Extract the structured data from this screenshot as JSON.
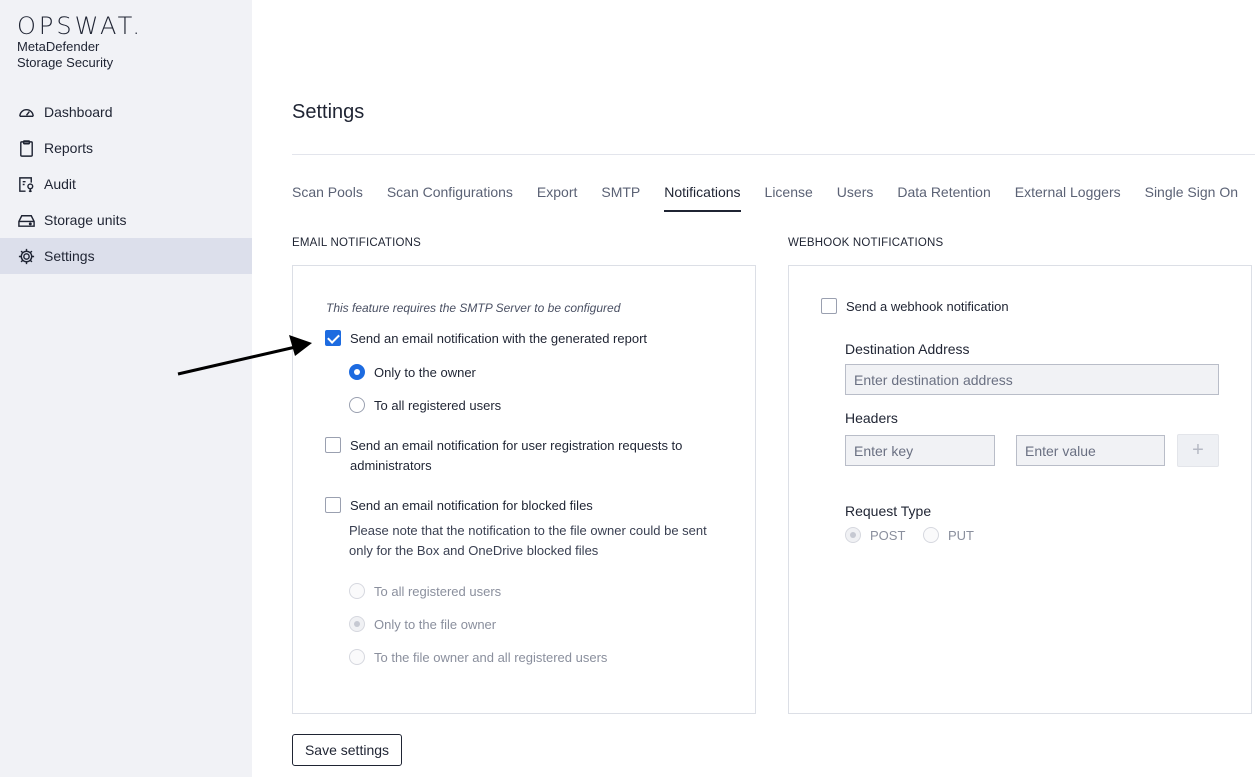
{
  "brand": {
    "logo": "OPSWAT.",
    "product_line1": "MetaDefender",
    "product_line2": "Storage Security"
  },
  "sidebar": {
    "items": [
      {
        "label": "Dashboard",
        "icon": "gauge-icon",
        "active": false
      },
      {
        "label": "Reports",
        "icon": "clipboard-icon",
        "active": false
      },
      {
        "label": "Audit",
        "icon": "audit-icon",
        "active": false
      },
      {
        "label": "Storage units",
        "icon": "drive-icon",
        "active": false
      },
      {
        "label": "Settings",
        "icon": "gear-icon",
        "active": true
      }
    ]
  },
  "page": {
    "title": "Settings"
  },
  "tabs": [
    {
      "label": "Scan Pools"
    },
    {
      "label": "Scan Configurations"
    },
    {
      "label": "Export"
    },
    {
      "label": "SMTP"
    },
    {
      "label": "Notifications",
      "active": true
    },
    {
      "label": "License"
    },
    {
      "label": "Users"
    },
    {
      "label": "Data Retention"
    },
    {
      "label": "External Loggers"
    },
    {
      "label": "Single Sign On"
    }
  ],
  "email": {
    "section_label": "EMAIL NOTIFICATIONS",
    "note": "This feature requires the SMTP Server to be configured",
    "report_checkbox": {
      "label": "Send an email notification with the generated report",
      "checked": true
    },
    "report_options": [
      {
        "label": "Only to the owner",
        "selected": true
      },
      {
        "label": "To all registered users",
        "selected": false
      }
    ],
    "registration_checkbox": {
      "label": "Send an email notification for user registration requests to administrators",
      "checked": false
    },
    "blocked_checkbox": {
      "label": "Send an email notification for blocked files",
      "checked": false
    },
    "blocked_description": "Please note that the notification to the file owner could be sent only for the Box and OneDrive blocked files",
    "blocked_options": [
      {
        "label": "To all registered users",
        "selected": false
      },
      {
        "label": "Only to the file owner",
        "selected": true
      },
      {
        "label": "To the file owner and all registered users",
        "selected": false
      }
    ]
  },
  "webhook": {
    "section_label": "WEBHOOK NOTIFICATIONS",
    "checkbox": {
      "label": "Send a webhook notification",
      "checked": false
    },
    "destination_label": "Destination Address",
    "destination_placeholder": "Enter destination address",
    "headers_label": "Headers",
    "key_placeholder": "Enter key",
    "value_placeholder": "Enter value",
    "add_symbol": "+",
    "request_type_label": "Request Type",
    "request_types": [
      {
        "label": "POST",
        "selected": true
      },
      {
        "label": "PUT",
        "selected": false
      }
    ]
  },
  "actions": {
    "save_label": "Save settings"
  },
  "colors": {
    "accent": "#1d6be0",
    "sidebar_bg": "#f1f2f6",
    "active_nav_bg": "#dcdfeb"
  }
}
